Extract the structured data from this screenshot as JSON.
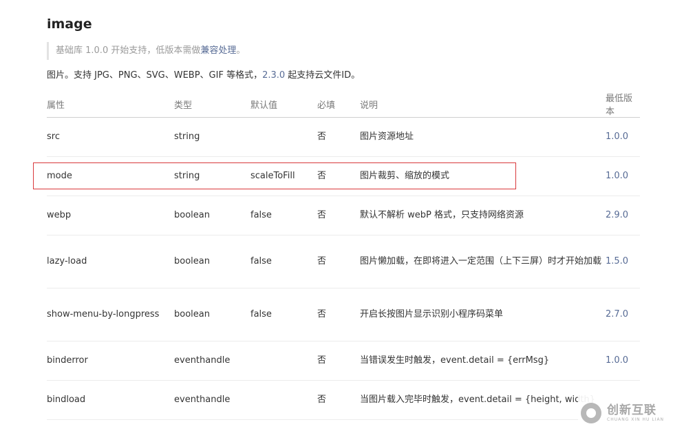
{
  "header": {
    "title": "image",
    "notice_prefix": "基础库 1.0.0 开始支持，低版本需做",
    "notice_link": "兼容处理",
    "notice_suffix": "。",
    "desc_prefix": "图片。支持 JPG、PNG、SVG、WEBP、GIF 等格式，",
    "desc_version": "2.3.0",
    "desc_suffix": " 起支持云文件ID。"
  },
  "table": {
    "headers": [
      "属性",
      "类型",
      "默认值",
      "必填",
      "说明",
      "最低版本"
    ],
    "rows": [
      {
        "attr": "src",
        "type": "string",
        "default": "",
        "required": "否",
        "desc": "图片资源地址",
        "version": "1.0.0"
      },
      {
        "attr": "mode",
        "type": "string",
        "default": "scaleToFill",
        "required": "否",
        "desc": "图片裁剪、缩放的模式",
        "version": "1.0.0"
      },
      {
        "attr": "webp",
        "type": "boolean",
        "default": "false",
        "required": "否",
        "desc": "默认不解析 webP 格式，只支持网络资源",
        "version": "2.9.0"
      },
      {
        "attr": "lazy-load",
        "type": "boolean",
        "default": "false",
        "required": "否",
        "desc": "图片懒加载，在即将进入一定范围（上下三屏）时才开始加载",
        "version": "1.5.0"
      },
      {
        "attr": "show-menu-by-longpress",
        "type": "boolean",
        "default": "false",
        "required": "否",
        "desc": "开启长按图片显示识别小程序码菜单",
        "version": "2.7.0"
      },
      {
        "attr": "binderror",
        "type": "eventhandle",
        "default": "",
        "required": "否",
        "desc": "当错误发生时触发，event.detail = {errMsg}",
        "version": "1.0.0"
      },
      {
        "attr": "bindload",
        "type": "eventhandle",
        "default": "",
        "required": "否",
        "desc": "当图片载入完毕时触发，event.detail = {height, width}",
        "version": ""
      }
    ]
  },
  "watermark": {
    "brand_cn": "创新互联",
    "brand_en": "CHUANG XIN HU LIAN"
  },
  "colors": {
    "link": "#576b95",
    "highlight_border": "#d9373a"
  }
}
